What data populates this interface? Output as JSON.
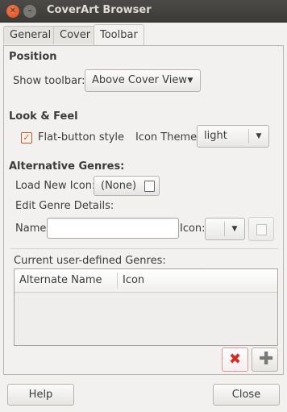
{
  "window": {
    "title": "CoverArt Browser"
  },
  "tabs": [
    {
      "label": "General"
    },
    {
      "label": "Cover"
    },
    {
      "label": "Toolbar"
    }
  ],
  "position": {
    "heading": "Position",
    "show_toolbar_label": "Show toolbar:",
    "show_toolbar_value": "Above Cover View"
  },
  "look_feel": {
    "heading": "Look & Feel",
    "flat_button_label": "Flat-button style",
    "flat_button_checked": true,
    "icon_theme_label": "Icon Theme:",
    "icon_theme_value": "light"
  },
  "alt_genres": {
    "heading": "Alternative Genres:",
    "load_icon_label": "Load New Icon:",
    "load_icon_value": "(None)",
    "edit_details_label": "Edit Genre Details:",
    "name_label": "Name:",
    "name_value": "",
    "icon_label": "Icon:",
    "icon_value": "",
    "current_label": "Current user-defined Genres:",
    "columns": [
      "Alternate Name",
      "Icon"
    ],
    "rows": []
  },
  "footer": {
    "help_label": "Help",
    "close_label": "Close"
  },
  "colors": {
    "accent": "#e05a1c",
    "delete_red": "#d42b1e",
    "titlebar": "#3c3b37"
  }
}
